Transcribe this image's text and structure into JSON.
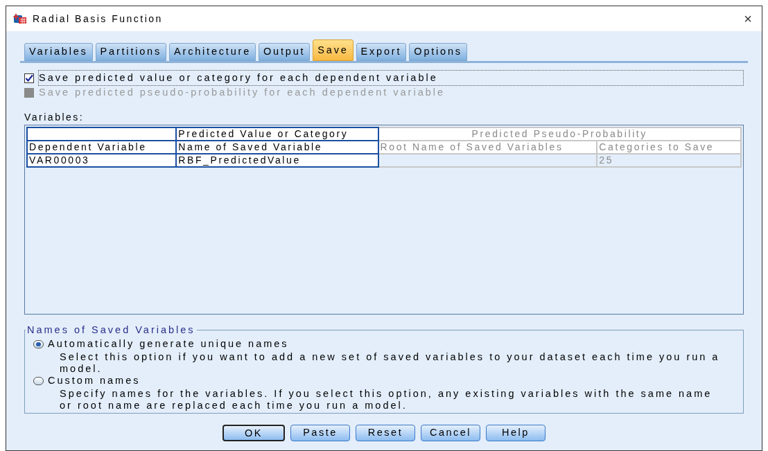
{
  "window": {
    "title": "Radial Basis Function",
    "close": "×"
  },
  "tabs": [
    {
      "label": "Variables",
      "selected": false
    },
    {
      "label": "Partitions",
      "selected": false
    },
    {
      "label": "Architecture",
      "selected": false
    },
    {
      "label": "Output",
      "selected": false
    },
    {
      "label": "Save",
      "selected": true
    },
    {
      "label": "Export",
      "selected": false
    },
    {
      "label": "Options",
      "selected": false
    }
  ],
  "options": [
    {
      "label": "Save predicted value or category for each dependent variable",
      "checked": true,
      "disabled": false,
      "focused": true
    },
    {
      "label": "Save predicted pseudo-probability for each dependent variable",
      "checked": false,
      "disabled": true,
      "focused": false
    }
  ],
  "variables": {
    "label": "Variables:",
    "group_headers": [
      {
        "disabled": false
      },
      {
        "text": "Predicted Value or Category",
        "disabled": false
      },
      {
        "text": "Predicted Pseudo-Probability",
        "disabled": true
      }
    ],
    "columns": [
      {
        "text": "Dependent Variable",
        "disabled": false
      },
      {
        "text": "Name of Saved Variable",
        "disabled": false
      },
      {
        "text": "Root Name of Saved Variables",
        "disabled": true
      },
      {
        "text": "Categories to Save",
        "disabled": true
      }
    ],
    "rows": [
      [
        "VAR00003",
        "RBF_PredictedValue",
        "",
        "25"
      ]
    ]
  },
  "names_group": {
    "title": "Names of Saved Variables",
    "options": [
      {
        "label": "Automatically generate unique names",
        "selected": true,
        "description": "Select this option if you want to add a new set of saved variables to your dataset each time you run a model."
      },
      {
        "label": "Custom names",
        "selected": false,
        "description": "Specify names for the variables. If you select this option, any existing variables with the same name or root name are replaced each time you run a model."
      }
    ]
  },
  "buttons": [
    {
      "label": "OK",
      "default": true
    },
    {
      "label": "Paste",
      "default": false
    },
    {
      "label": "Reset",
      "default": false
    },
    {
      "label": "Cancel",
      "default": false
    },
    {
      "label": "Help",
      "default": false
    }
  ]
}
